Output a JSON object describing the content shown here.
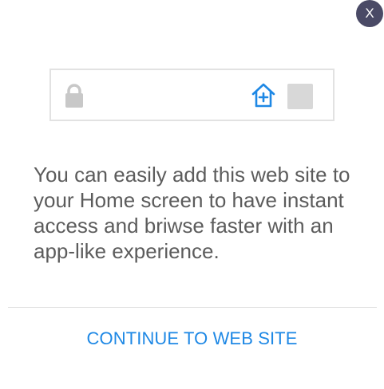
{
  "close_button": {
    "label": "X"
  },
  "address_bar": {
    "icons": [
      "lock-icon",
      "add-to-home-icon",
      "menu-square-icon"
    ],
    "accent_color": "#1e88e5"
  },
  "message": "You can easily add this web site to your Home screen to have instant access and briwse faster with an app-like experience.",
  "continue_button": {
    "label": "CONTINUE TO WEB SITE"
  },
  "colors": {
    "link": "#1e88e5",
    "text": "#5c5c5c",
    "close_bg": "#4a4a66"
  }
}
